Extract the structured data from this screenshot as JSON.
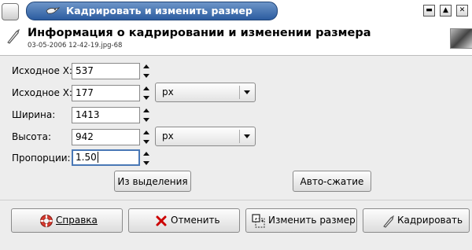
{
  "window": {
    "title": "Кадрировать и изменить размер"
  },
  "header": {
    "title": "Информация о кадрировании и изменении размера",
    "subtitle": "03-05-2006 12-42-19.jpg-68"
  },
  "fields": {
    "origin_x": {
      "label": "Исходное X:",
      "value": "537"
    },
    "origin_y": {
      "label": "Исходное Х:",
      "value": "177"
    },
    "width": {
      "label": "Ширина:",
      "value": "1413"
    },
    "height": {
      "label": "Высота:",
      "value": "942"
    },
    "ratio": {
      "label": "Пропорции:",
      "value": "1.50"
    }
  },
  "units": {
    "position_unit": "px",
    "size_unit": "px"
  },
  "actions": {
    "from_selection": "Из выделения",
    "auto_shrink": "Авто-сжатие"
  },
  "buttons": {
    "help": "Справка",
    "cancel": "Отменить",
    "resize": "Изменить размер",
    "crop": "Кадрировать"
  },
  "colors": {
    "title_bar": "#2c5ca0",
    "focus_border": "#4a78b6",
    "cancel_icon": "#cc0000"
  }
}
